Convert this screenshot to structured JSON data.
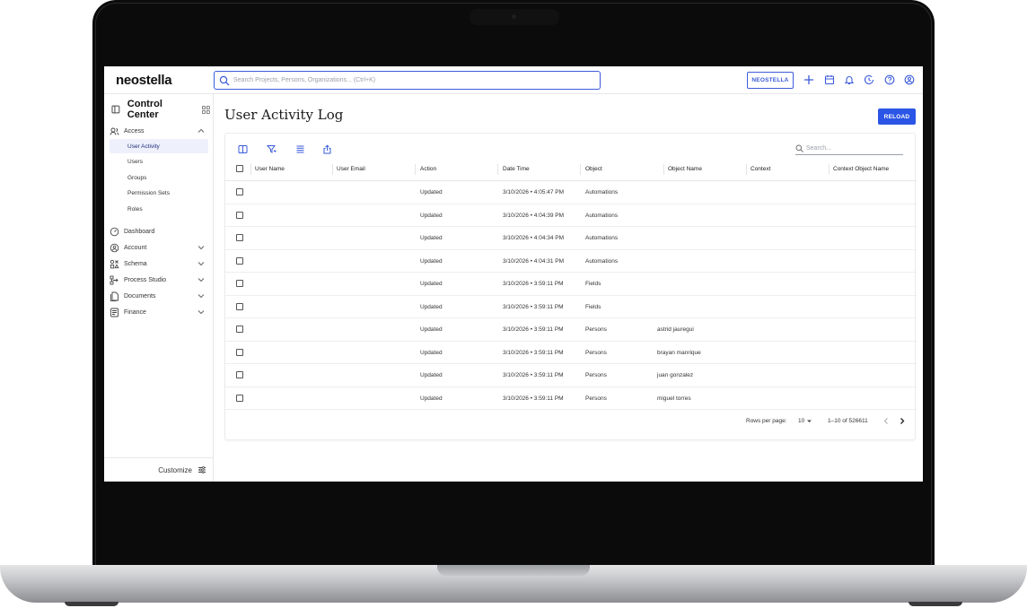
{
  "topbar": {
    "logo": "neostella",
    "search_placeholder": "Search Projects, Persons, Organizations... (Ctrl+K)",
    "org_button": "NEOSTELLA",
    "icons": [
      "plus-icon",
      "calendar-icon",
      "bell-icon",
      "history-icon",
      "help-icon",
      "user-icon"
    ]
  },
  "sidebar": {
    "title": "Control Center",
    "access": {
      "label": "Access",
      "items": [
        {
          "label": "User Activity",
          "active": true
        },
        {
          "label": "Users"
        },
        {
          "label": "Groups"
        },
        {
          "label": "Permission Sets"
        },
        {
          "label": "Roles"
        }
      ]
    },
    "sections": [
      {
        "label": "Dashboard",
        "icon": "dashboard-icon",
        "expandable": false
      },
      {
        "label": "Account",
        "icon": "account-icon",
        "expandable": true
      },
      {
        "label": "Schema",
        "icon": "schema-icon",
        "expandable": true
      },
      {
        "label": "Process Studio",
        "icon": "process-studio-icon",
        "expandable": true
      },
      {
        "label": "Documents",
        "icon": "documents-icon",
        "expandable": true
      },
      {
        "label": "Finance",
        "icon": "finance-icon",
        "expandable": true
      }
    ],
    "customize": "Customize"
  },
  "main": {
    "title": "User Activity Log",
    "reload": "RELOAD",
    "table_search_placeholder": "Search...",
    "columns": [
      "User Name",
      "User Email",
      "Action",
      "Date Time",
      "Object",
      "Object Name",
      "Context",
      "Context Object Name"
    ],
    "rows": [
      {
        "action": "Updated",
        "datetime": "3/10/2026 • 4:05:47 PM",
        "object": "Automations",
        "object_name": ""
      },
      {
        "action": "Updated",
        "datetime": "3/10/2026 • 4:04:39 PM",
        "object": "Automations",
        "object_name": ""
      },
      {
        "action": "Updated",
        "datetime": "3/10/2026 • 4:04:34 PM",
        "object": "Automations",
        "object_name": ""
      },
      {
        "action": "Updated",
        "datetime": "3/10/2026 • 4:04:31 PM",
        "object": "Automations",
        "object_name": ""
      },
      {
        "action": "Updated",
        "datetime": "3/10/2026 • 3:59:11 PM",
        "object": "Fields",
        "object_name": ""
      },
      {
        "action": "Updated",
        "datetime": "3/10/2026 • 3:59:11 PM",
        "object": "Fields",
        "object_name": ""
      },
      {
        "action": "Updated",
        "datetime": "3/10/2026 • 3:59:11 PM",
        "object": "Persons",
        "object_name": "astrid jauregui"
      },
      {
        "action": "Updated",
        "datetime": "3/10/2026 • 3:59:11 PM",
        "object": "Persons",
        "object_name": "brayan manrique"
      },
      {
        "action": "Updated",
        "datetime": "3/10/2026 • 3:59:11 PM",
        "object": "Persons",
        "object_name": "juan gonzalez"
      },
      {
        "action": "Updated",
        "datetime": "3/10/2026 • 3:59:11 PM",
        "object": "Persons",
        "object_name": "miguel torres"
      }
    ],
    "pagination": {
      "rows_per_page_label": "Rows per page:",
      "rows_per_page": "10",
      "range": "1–10 of 526611"
    }
  },
  "colors": {
    "accent": "#2b55e6",
    "active_bg": "#eef1fb"
  }
}
